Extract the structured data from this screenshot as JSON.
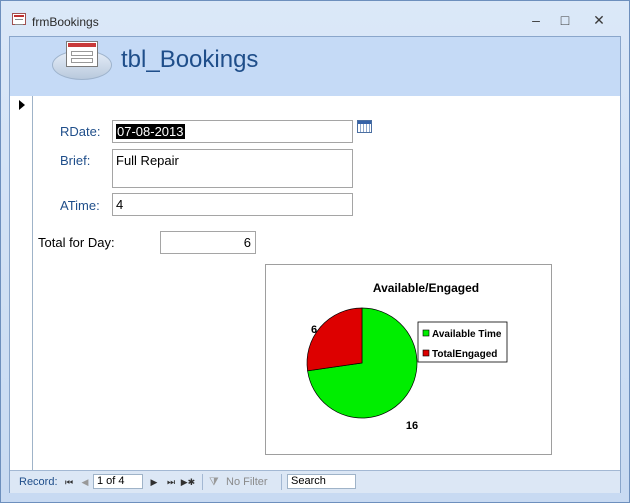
{
  "window": {
    "title": "frmBookings",
    "minimize": "–",
    "maximize": "□",
    "close": "✕"
  },
  "form": {
    "title": "tbl_Bookings",
    "fields": {
      "rdate": {
        "label": "RDate:",
        "value": "07-08-2013"
      },
      "brief": {
        "label": "Brief:",
        "value": "Full Repair"
      },
      "atime": {
        "label": "ATime:",
        "value": "4"
      },
      "total": {
        "label": "Total for Day:",
        "value": "6"
      }
    }
  },
  "chart_data": {
    "type": "pie",
    "title": "Available/Engaged",
    "categories": [
      "Available Time",
      "TotalEngaged"
    ],
    "values": [
      16,
      6
    ],
    "colors": [
      "#00ee00",
      "#dd0000"
    ],
    "legend": "right"
  },
  "navigation": {
    "record_label": "Record:",
    "first": "⏮",
    "prev": "◀",
    "position": "1 of 4",
    "next": "▶",
    "last": "⏭",
    "new": "▶✱",
    "filter_icon": "⧩",
    "no_filter": "No Filter",
    "search": "Search"
  }
}
